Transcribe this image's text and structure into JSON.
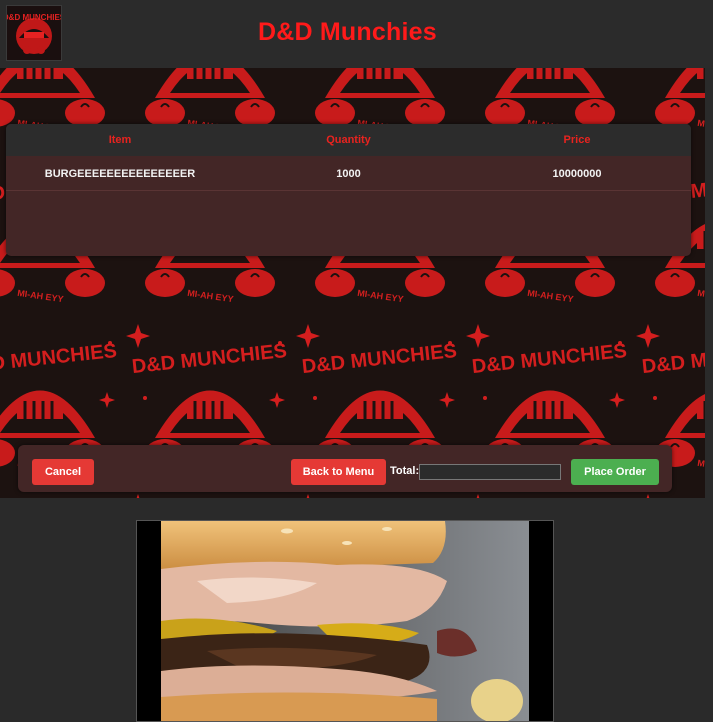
{
  "header": {
    "title": "D&D Munchies",
    "logo_text": "D&D MUNCHIES"
  },
  "banner": {
    "pattern_text": "D&D MUNCHIES",
    "tagline": "MI-AH EYY"
  },
  "order_table": {
    "columns": [
      "Item",
      "Quantity",
      "Price"
    ],
    "rows": [
      {
        "item": "BURGEEEEEEEEEEEEEEER",
        "quantity": "1000",
        "price": "10000000"
      }
    ]
  },
  "actions": {
    "cancel_label": "Cancel",
    "back_label": "Back to Menu",
    "total_label": "Total:",
    "total_value": "",
    "place_label": "Place Order"
  },
  "colors": {
    "brand_red": "#ff1a1a",
    "panel_bg": "#432626",
    "cancel_red": "#e53935",
    "place_green": "#4caf50"
  },
  "media": {
    "icon": "burger-photo"
  }
}
